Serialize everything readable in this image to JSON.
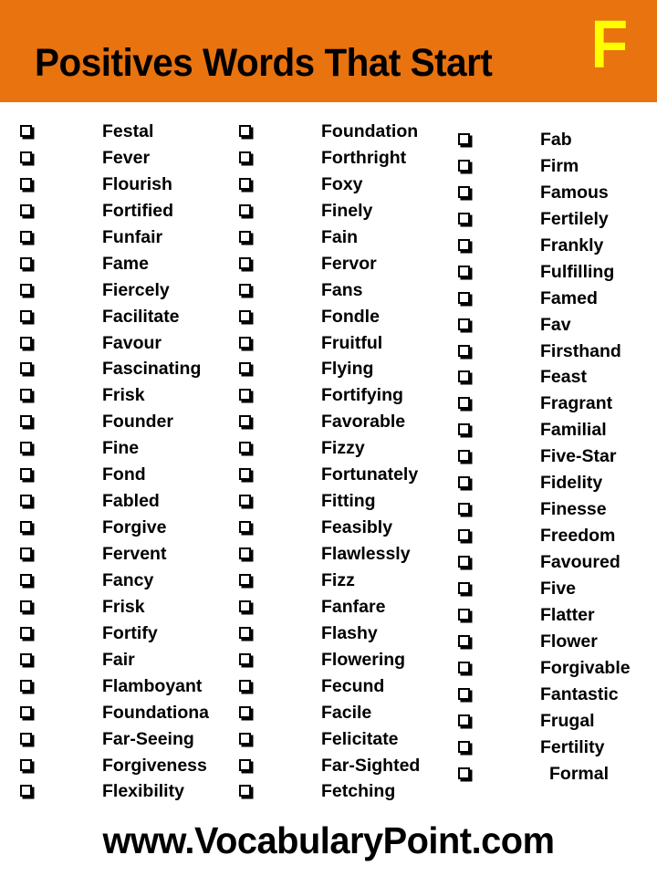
{
  "header": {
    "title": "Positives Words That Start",
    "letter": "F",
    "background_color": "#E8730F",
    "letter_color": "#FFFF00",
    "title_color": "#000000"
  },
  "footer": {
    "text": "www.VocabularyPoint.com"
  },
  "checkbox_icon_name": "checkbox-square-icon",
  "columns": [
    {
      "id": "column-1",
      "words": [
        "Festal",
        "Fever",
        "Flourish",
        "Fortified",
        "Funfair",
        "Fame",
        "Fiercely",
        "Facilitate",
        "Favour",
        "Fascinating",
        "Frisk",
        "Founder",
        "Fine",
        "Fond",
        "Fabled",
        "Forgive",
        "Fervent",
        "Fancy",
        "Frisk",
        "Fortify",
        "Fair",
        "Flamboyant",
        "Foundationa",
        "Far-Seeing",
        "Forgiveness",
        "Flexibility"
      ]
    },
    {
      "id": "column-2",
      "words": [
        "Foundation",
        "Forthright",
        "Foxy",
        "Finely",
        "Fain",
        "Fervor",
        "Fans",
        "Fondle",
        "Fruitful",
        "Flying",
        "Fortifying",
        "Favorable",
        "Fizzy",
        "Fortunately",
        "Fitting",
        "Feasibly",
        "Flawlessly",
        "Fizz",
        "Fanfare",
        "Flashy",
        "Flowering",
        "Fecund",
        "Facile",
        "Felicitate",
        "Far-Sighted",
        "Fetching"
      ]
    },
    {
      "id": "column-3",
      "words": [
        "Fab",
        "Firm",
        "Famous",
        "Fertilely",
        "Frankly",
        "Fulfilling",
        "Famed",
        "Fav",
        "Firsthand",
        "Feast",
        "Fragrant",
        "Familial",
        "Five-Star",
        "Fidelity",
        "Finesse",
        "Freedom",
        "Favoured",
        "Five",
        "Flatter",
        "Flower",
        "Forgivable",
        "Fantastic",
        "Frugal",
        "Fertility",
        "Formal"
      ],
      "indented_indices": [
        24
      ]
    }
  ]
}
